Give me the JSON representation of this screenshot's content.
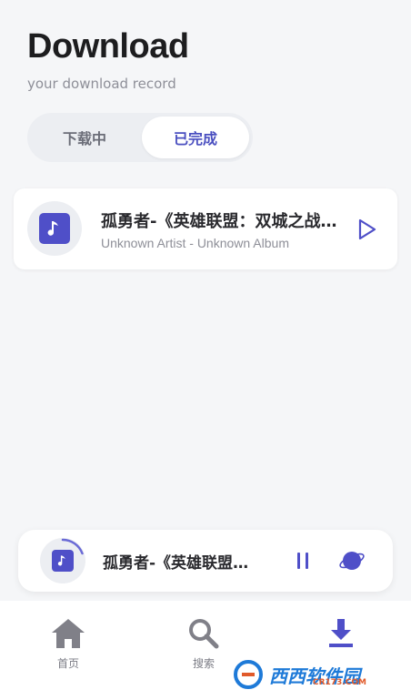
{
  "header": {
    "title": "Download",
    "subtitle": "your download record"
  },
  "tabs": [
    {
      "label": "下载中",
      "active": false
    },
    {
      "label": "已完成",
      "active": true
    }
  ],
  "downloads": [
    {
      "title": "孤勇者-《英雄联盟：双城之战》动画剧集中文主题曲",
      "meta": "Unknown Artist - Unknown Album",
      "cover_icon": "music-note-icon",
      "action_icon": "play-icon"
    }
  ],
  "mini_player": {
    "title": "孤勇者-《英雄联盟：双城之战》动画剧集中文主题曲",
    "progress": 0.2,
    "icons": [
      "music-note-icon",
      "pause-icon",
      "planet-icon"
    ]
  },
  "bottom_nav": [
    {
      "label": "首页",
      "icon": "home-icon",
      "active": false
    },
    {
      "label": "搜索",
      "icon": "search-icon",
      "active": false
    },
    {
      "label": "下载",
      "icon": "download-icon",
      "active": true
    }
  ],
  "watermark": {
    "text": "西西软件园",
    "sub": "CR173.COM"
  },
  "colors": {
    "accent": "#4f4fc8",
    "background": "#f5f6f8",
    "card": "#ffffff"
  }
}
